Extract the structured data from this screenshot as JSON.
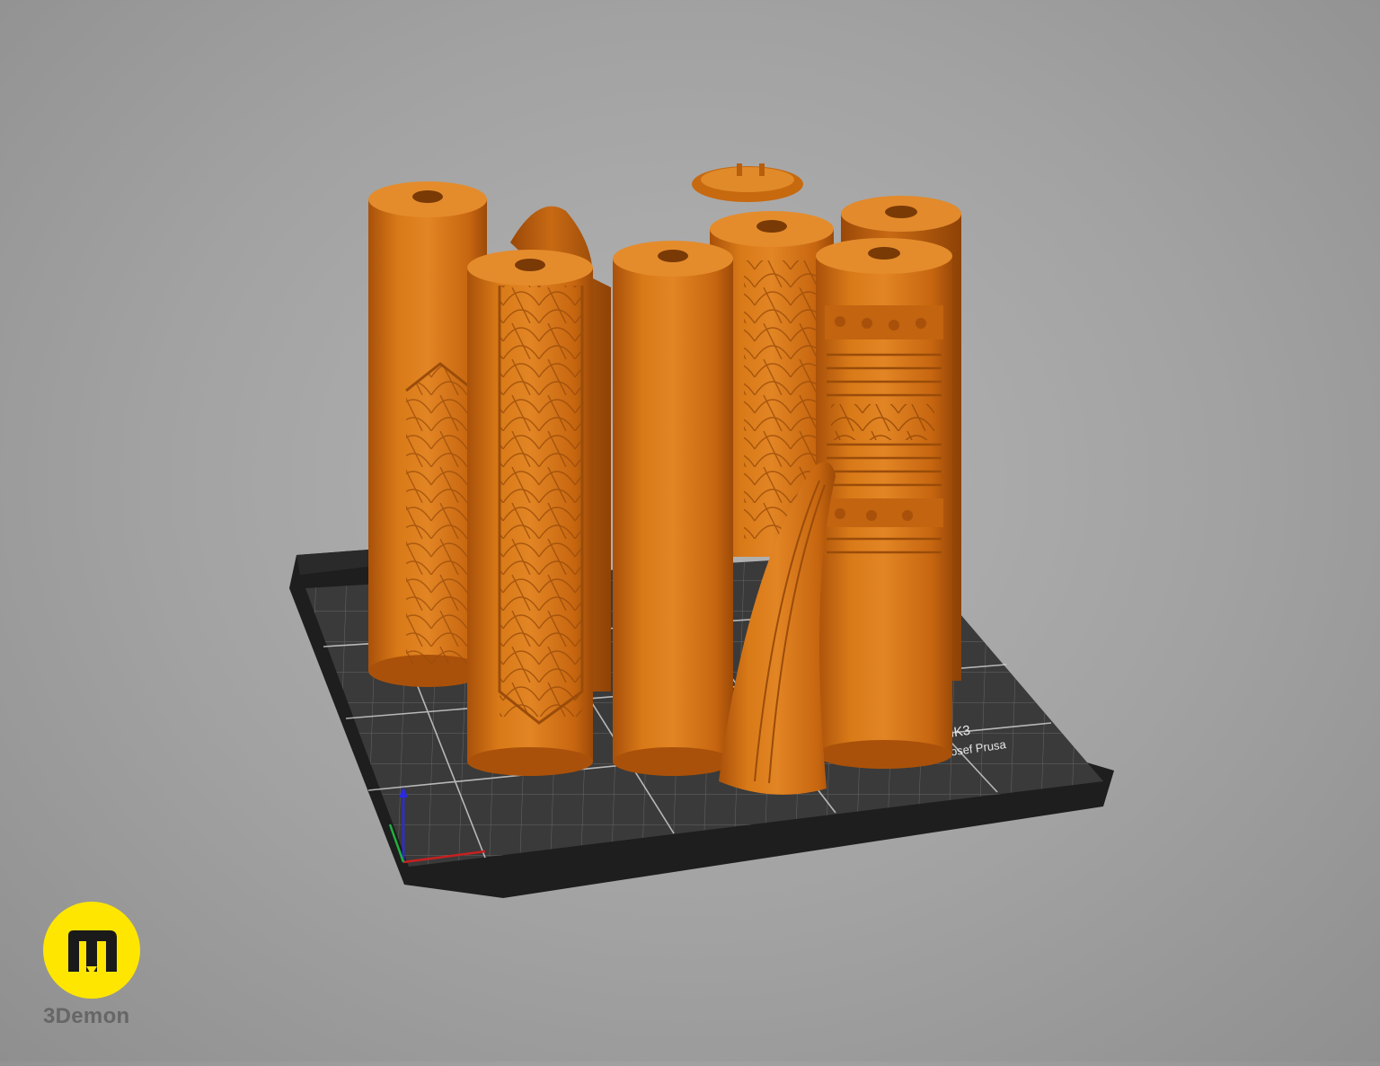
{
  "app": {
    "view": "3D build plate preview"
  },
  "bed": {
    "brand_line": "PRUSA i3 MK3",
    "byline": "by Josef Prusa",
    "model_label": "MK3"
  },
  "axes": {
    "x_color": "#d02020",
    "y_color": "#20c040",
    "z_color": "#2020e0"
  },
  "model": {
    "color": "#d26b0f",
    "parts": [
      "tall-cylinder-left",
      "patterned-cylinder",
      "plain-cylinder-center",
      "patterned-cylinder-rear",
      "ringed-cylinder-right",
      "curved-horn",
      "cap-disc",
      "dome-piece"
    ]
  },
  "brand": {
    "name": "3Demon",
    "logo_color": "#ffe600"
  }
}
